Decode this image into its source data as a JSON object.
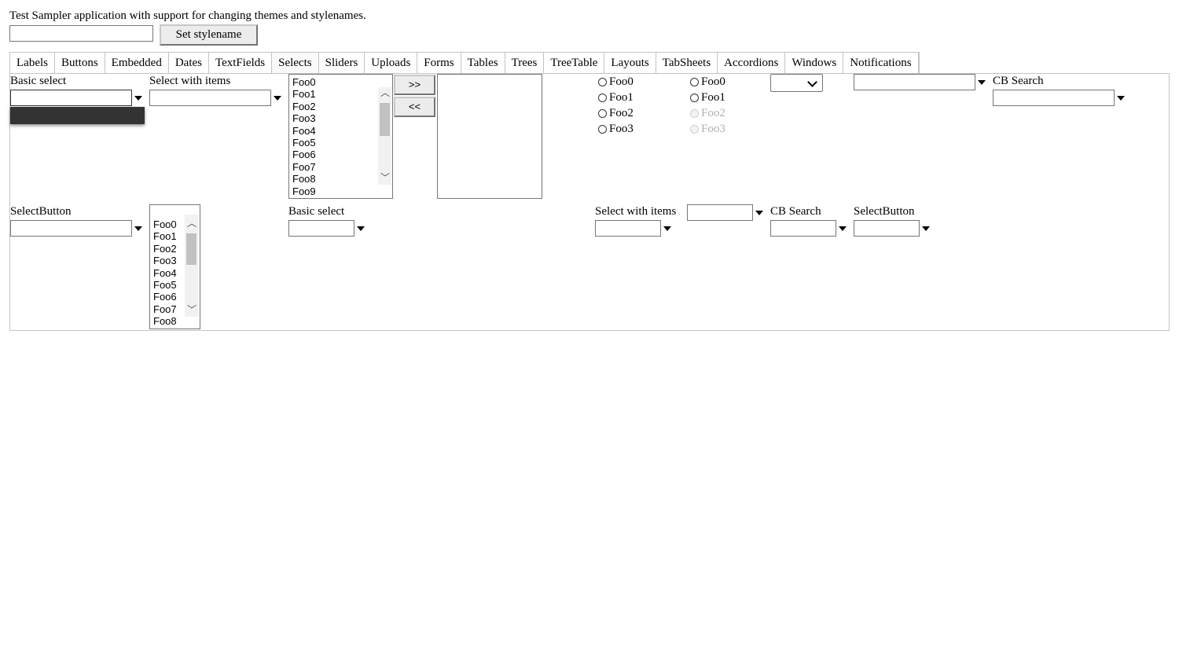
{
  "app": {
    "description": "Test Sampler application with support for changing themes and stylenames.",
    "stylename_value": "",
    "set_stylename_label": "Set stylename"
  },
  "tabs": [
    "Labels",
    "Buttons",
    "Embedded",
    "Dates",
    "TextFields",
    "Selects",
    "Sliders",
    "Uploads",
    "Forms",
    "Tables",
    "Trees",
    "TreeTable",
    "Layouts",
    "TabSheets",
    "Accordions",
    "Windows",
    "Notifications"
  ],
  "selected_tab": "Selects",
  "row1": {
    "basic_select_caption": "Basic select",
    "select_with_items_caption": "Select with items",
    "twincol_options": [
      "Foo0",
      "Foo1",
      "Foo2",
      "Foo3",
      "Foo4",
      "Foo5",
      "Foo6",
      "Foo7",
      "Foo8",
      "Foo9"
    ],
    "add_label": ">>",
    "remove_label": "<<",
    "option_group": [
      "Foo0",
      "Foo1",
      "Foo2",
      "Foo3"
    ],
    "option_group_disabled": [
      "Foo0",
      "Foo1",
      "Foo2",
      "Foo3"
    ],
    "cb_search_caption": "CB Search"
  },
  "row2": {
    "selectbutton_caption": "SelectButton",
    "listbox_options": [
      "Foo0",
      "Foo1",
      "Foo2",
      "Foo3",
      "Foo4",
      "Foo5",
      "Foo6",
      "Foo7",
      "Foo8"
    ],
    "basic_select_caption": "Basic select",
    "select_with_items_caption": "Select with items",
    "cb_search_caption": "CB Search",
    "selectbutton_caption_2": "SelectButton"
  }
}
